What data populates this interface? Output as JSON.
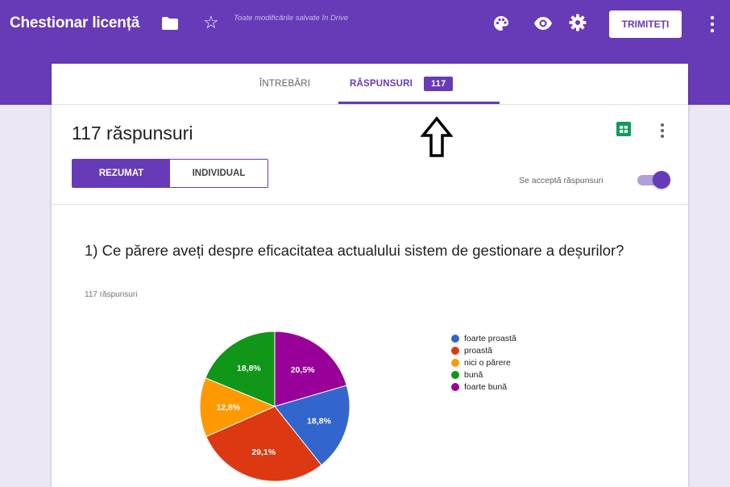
{
  "header": {
    "title": "Chestionar licență",
    "save_status": "Toate modificările salvate în Drive",
    "send_label": "TRIMITEȚI",
    "icons": [
      "folder-icon",
      "star-icon",
      "palette-icon",
      "eye-icon",
      "gear-icon",
      "more-vert-icon"
    ]
  },
  "tabs": {
    "questions": "ÎNTREBĂRI",
    "responses": "RĂSPUNSURI",
    "responses_count": "117"
  },
  "summary": {
    "count_label": "117 răspunsuri",
    "view_summary": "REZUMAT",
    "view_individual": "INDIVIDUAL",
    "accepting_label": "Se acceptă răspunsuri",
    "accepting_on": true
  },
  "question": {
    "title": "1) Ce părere aveți despre eficacitatea actualului sistem de gestionare a deșurilor?",
    "response_count": "117 răspunsuri"
  },
  "colors": {
    "brand": "#673ab7",
    "foarte_proasta": "#3366cc",
    "proasta": "#dc3912",
    "nici_o_parere": "#ff9900",
    "buna": "#109618",
    "foarte_buna": "#990099"
  },
  "chart_data": {
    "type": "pie",
    "categories": [
      "foarte proastă",
      "proastă",
      "nici o părere",
      "bună",
      "foarte bună"
    ],
    "values": [
      18.8,
      29.1,
      12.8,
      18.8,
      20.5
    ],
    "value_labels": [
      "18,8%",
      "29,1%",
      "12,8%",
      "18,8%",
      "20,5%"
    ],
    "colors": [
      "#3366cc",
      "#dc3912",
      "#ff9900",
      "#109618",
      "#990099"
    ],
    "legend_position": "right"
  }
}
